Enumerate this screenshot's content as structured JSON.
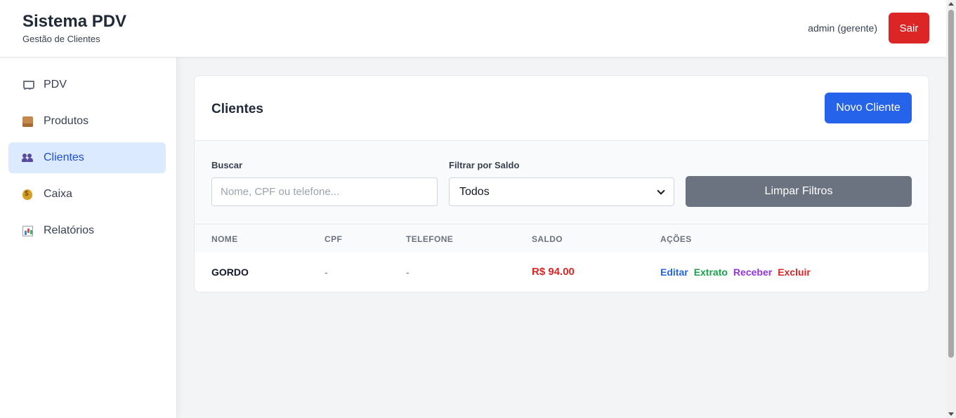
{
  "header": {
    "title": "Sistema PDV",
    "subtitle": "Gestão de Clientes",
    "user": "admin (gerente)",
    "logout_label": "Sair"
  },
  "sidebar": {
    "items": [
      {
        "label": "PDV",
        "icon": "cart-icon"
      },
      {
        "label": "Produtos",
        "icon": "box-icon"
      },
      {
        "label": "Clientes",
        "icon": "people-icon",
        "active": true
      },
      {
        "label": "Caixa",
        "icon": "money-bag-icon"
      },
      {
        "label": "Relatórios",
        "icon": "bar-chart-icon"
      }
    ]
  },
  "clients_card": {
    "title": "Clientes",
    "new_button": "Novo Cliente",
    "filters": {
      "search_label": "Buscar",
      "search_placeholder": "Nome, CPF ou telefone...",
      "search_value": "",
      "balance_label": "Filtrar por Saldo",
      "balance_selected": "Todos",
      "clear_button": "Limpar Filtros"
    },
    "table": {
      "columns": [
        "NOME",
        "CPF",
        "TELEFONE",
        "SALDO",
        "AÇÕES"
      ],
      "rows": [
        {
          "name": "GORDO",
          "cpf": "-",
          "phone": "-",
          "balance": "R$ 94.00",
          "actions": [
            "Editar",
            "Extrato",
            "Receber",
            "Excluir"
          ]
        }
      ]
    }
  },
  "colors": {
    "primary": "#2563eb",
    "danger": "#dc2626",
    "success": "#16a34a",
    "purple": "#9333ea",
    "neutral_button": "#6b7280",
    "active_nav_bg": "#dbeafe"
  }
}
